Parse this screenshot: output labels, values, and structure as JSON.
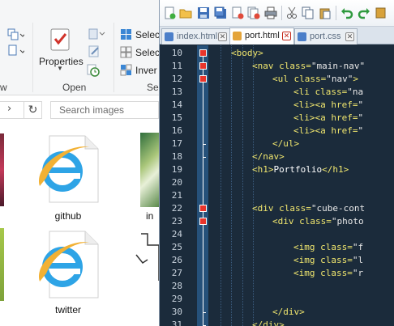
{
  "explorer": {
    "ribbon": {
      "properties_label": "Properties",
      "open_group_label": "Open",
      "left_group_label": "w",
      "select_items": [
        "Selec",
        "Selec",
        "Inver"
      ],
      "right_group_label": "Se"
    },
    "search_placeholder": "Search images",
    "files": [
      {
        "name": "github"
      },
      {
        "name": "in"
      },
      {
        "name": "twitter"
      }
    ]
  },
  "editor": {
    "tabs": [
      {
        "label": "index.html",
        "active": false
      },
      {
        "label": "port.html",
        "active": true
      },
      {
        "label": "port.css",
        "active": false
      }
    ],
    "line_numbers": [
      "10",
      "11",
      "12",
      "13",
      "14",
      "15",
      "16",
      "17",
      "18",
      "19",
      "20",
      "21",
      "22",
      "23",
      "24",
      "25",
      "26",
      "27",
      "28",
      "29",
      "30",
      "31"
    ],
    "lines": [
      {
        "indent": 2,
        "parts": [
          [
            "tag",
            "<body>"
          ]
        ]
      },
      {
        "indent": 4,
        "parts": [
          [
            "tag",
            "<nav "
          ],
          [
            "attr",
            "class="
          ],
          [
            "val",
            "\"main-nav\""
          ]
        ]
      },
      {
        "indent": 6,
        "parts": [
          [
            "tag",
            "<ul "
          ],
          [
            "attr",
            "class="
          ],
          [
            "val",
            "\"nav\""
          ],
          [
            "tag",
            ">"
          ]
        ]
      },
      {
        "indent": 8,
        "parts": [
          [
            "tag",
            "<li "
          ],
          [
            "attr",
            "class="
          ],
          [
            "val",
            "\"na"
          ]
        ]
      },
      {
        "indent": 8,
        "parts": [
          [
            "tag",
            "<li><a "
          ],
          [
            "attr",
            "href="
          ],
          [
            "val",
            "\""
          ]
        ]
      },
      {
        "indent": 8,
        "parts": [
          [
            "tag",
            "<li><a "
          ],
          [
            "attr",
            "href="
          ],
          [
            "val",
            "\""
          ]
        ]
      },
      {
        "indent": 8,
        "parts": [
          [
            "tag",
            "<li><a "
          ],
          [
            "attr",
            "href="
          ],
          [
            "val",
            "\""
          ]
        ]
      },
      {
        "indent": 6,
        "parts": [
          [
            "tag",
            "</ul>"
          ]
        ]
      },
      {
        "indent": 4,
        "parts": [
          [
            "tag",
            "</nav>"
          ]
        ]
      },
      {
        "indent": 4,
        "parts": [
          [
            "tag",
            "<h1>"
          ],
          [
            "txt",
            "Portfolio"
          ],
          [
            "tag",
            "</h1>"
          ]
        ]
      },
      {
        "indent": 0,
        "parts": []
      },
      {
        "indent": 0,
        "parts": []
      },
      {
        "indent": 4,
        "parts": [
          [
            "tag",
            "<div "
          ],
          [
            "attr",
            "class="
          ],
          [
            "val",
            "\"cube-cont"
          ]
        ]
      },
      {
        "indent": 6,
        "parts": [
          [
            "tag",
            "<div "
          ],
          [
            "attr",
            "class="
          ],
          [
            "val",
            "\"photo"
          ]
        ]
      },
      {
        "indent": 0,
        "parts": []
      },
      {
        "indent": 8,
        "parts": [
          [
            "tag",
            "<img "
          ],
          [
            "attr",
            "class="
          ],
          [
            "val",
            "\"f"
          ]
        ]
      },
      {
        "indent": 8,
        "parts": [
          [
            "tag",
            "<img "
          ],
          [
            "attr",
            "class="
          ],
          [
            "val",
            "\"l"
          ]
        ]
      },
      {
        "indent": 8,
        "parts": [
          [
            "tag",
            "<img "
          ],
          [
            "attr",
            "class="
          ],
          [
            "val",
            "\"r"
          ]
        ]
      },
      {
        "indent": 0,
        "parts": []
      },
      {
        "indent": 0,
        "parts": []
      },
      {
        "indent": 6,
        "parts": [
          [
            "tag",
            "</div>"
          ]
        ]
      },
      {
        "indent": 4,
        "parts": [
          [
            "tag",
            "</div>"
          ]
        ]
      }
    ]
  }
}
